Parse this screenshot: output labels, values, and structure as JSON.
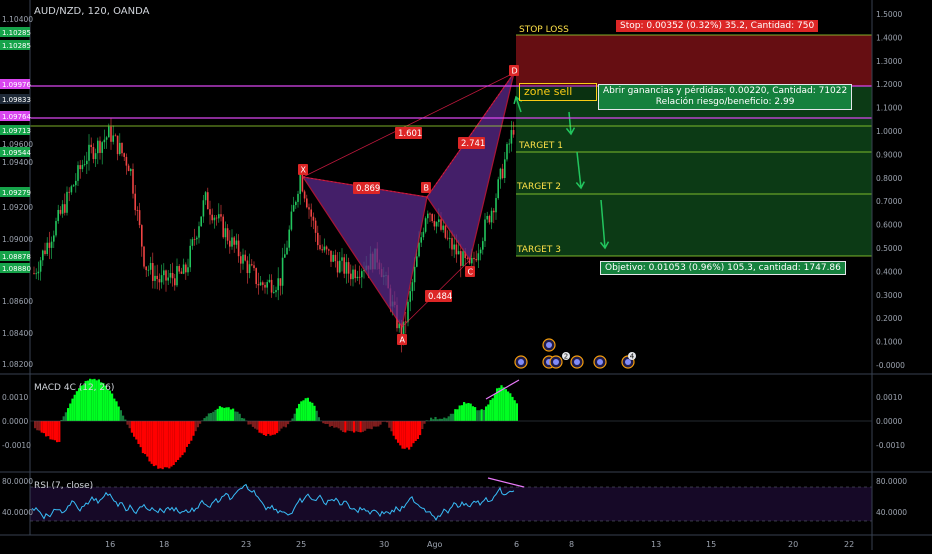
{
  "header": {
    "symbol": "AUD/NZD, 120, OANDA"
  },
  "colors": {
    "background": "#000000",
    "bull": "#22c55e",
    "bear": "#ef4444",
    "pattern_fill": "#5b2a8c",
    "pattern_edge": "#e11d48",
    "magenta": "#d946ef",
    "stop_zone": "#6b0f13",
    "profit_zone": "#0d3d16",
    "target_line": "#a3e635",
    "rsi": "#38bdf8"
  },
  "price_axis_left": {
    "ticks": [
      "1.10400",
      "1.09600",
      "1.09400",
      "1.09200",
      "1.09000",
      "1.08600",
      "1.08400",
      "1.08200"
    ],
    "badges": [
      {
        "text": "1.10285",
        "color": "#16a34a"
      },
      {
        "text": "1.10285",
        "color": "#16a34a"
      },
      {
        "text": "1.09976",
        "color": "#d946ef"
      },
      {
        "text": "1.09833",
        "color": "#1f2937"
      },
      {
        "text": "1.09764",
        "color": "#d946ef"
      },
      {
        "text": "1.09713",
        "color": "#16a34a"
      },
      {
        "text": "1.09544",
        "color": "#16a34a"
      },
      {
        "text": "1.09279",
        "color": "#16a34a"
      },
      {
        "text": "1.08878",
        "color": "#16a34a"
      },
      {
        "text": "1.08880",
        "color": "#16a34a"
      }
    ]
  },
  "price_axis_right": {
    "ticks": [
      "1.5000",
      "1.4000",
      "1.3000",
      "1.2000",
      "1.1000",
      "1.0000",
      "0.9000",
      "0.8000",
      "0.7000",
      "0.6000",
      "0.5000",
      "0.4000",
      "0.3000",
      "0.2000",
      "0.1000",
      "-0.0000"
    ]
  },
  "time_axis": {
    "ticks": [
      "16",
      "18",
      "23",
      "25",
      "30",
      "Ago",
      "6",
      "8",
      "13",
      "15",
      "20",
      "22"
    ]
  },
  "pattern": {
    "points": [
      {
        "name": "X",
        "label": "X",
        "date": "25",
        "price": 1.0941
      },
      {
        "name": "A",
        "label": "A",
        "date": "31",
        "price": 1.0843
      },
      {
        "name": "B",
        "label": "B",
        "date": "1 Ago",
        "price": 1.0926
      },
      {
        "name": "C",
        "label": "C",
        "date": "3 Ago",
        "price": 1.0887
      },
      {
        "name": "D",
        "label": "D",
        "date": "5 Ago",
        "price": 1.0998
      }
    ],
    "ratios": [
      {
        "name": "xb",
        "text": "0.869"
      },
      {
        "name": "ac",
        "text": "0.484"
      },
      {
        "name": "xd",
        "text": "1.601"
      },
      {
        "name": "bd",
        "text": "2.741"
      }
    ]
  },
  "trade": {
    "zone_sell": "zone sell",
    "stop_loss": "STOP LOSS",
    "targets": [
      "TARGET 1",
      "TARGET 2",
      "TARGET 3"
    ],
    "stop_info": "Stop: 0.00352 (0.32%) 35.2, Cantidad: 750",
    "pnl_info_1": "Abrir ganancias y pérdidas: 0.00220, Cantidad: 71022",
    "pnl_info_2": "Relación riesgo/beneficio: 2.99",
    "target_info": "Objetivo: 0.01053 (0.96%) 105.3, cantidad: 1747.86"
  },
  "macd": {
    "label": "MACD 4C (12, 26)",
    "ticks": [
      "0.0010",
      "0.0000",
      "-0.0010"
    ]
  },
  "rsi": {
    "label": "RSI (7, close)",
    "ticks": [
      "80.0000",
      "40.0000"
    ]
  },
  "events": {
    "badges": [
      "2",
      "4"
    ]
  }
}
